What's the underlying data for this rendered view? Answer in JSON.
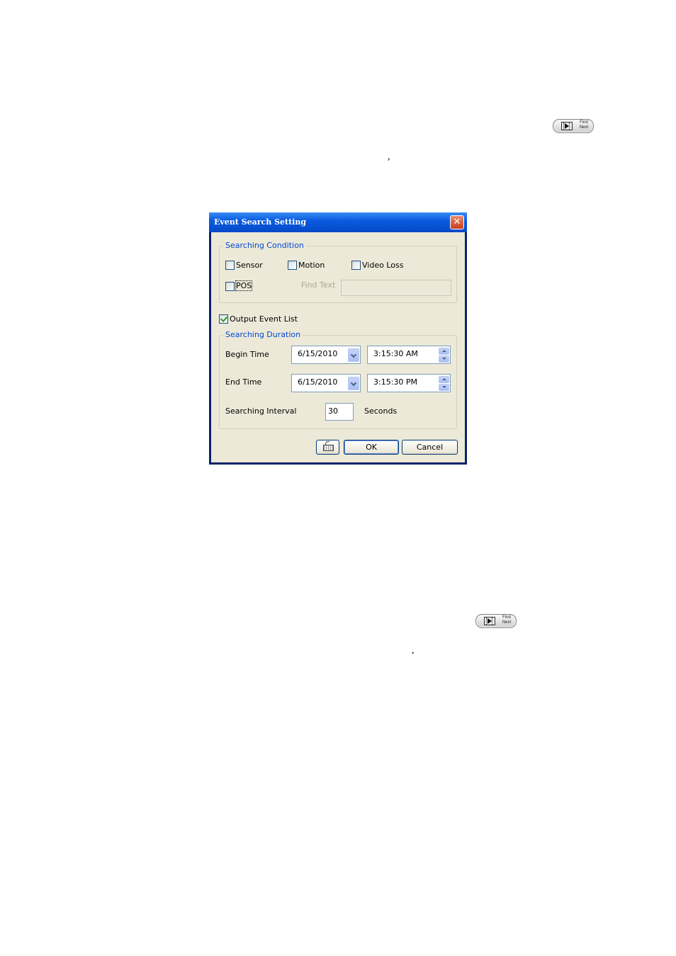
{
  "doc": {
    "comma_1": ",",
    "comma_2": ",",
    "find_next_label_top": "Find\nNext",
    "find_next_label_bottom": "Find\nNext"
  },
  "dialog": {
    "title": "Event Search Setting",
    "close_glyph": "✕",
    "searching_condition": {
      "legend": "Searching Condition",
      "sensor": {
        "label": "Sensor",
        "checked": false
      },
      "motion": {
        "label": "Motion",
        "checked": false
      },
      "video_loss": {
        "label": "Video Loss",
        "checked": false
      },
      "pos": {
        "label": "POS",
        "checked": false
      },
      "find_text_label": "Find Text",
      "find_text_value": ""
    },
    "output_event_list": {
      "label": "Output Event List",
      "checked": true
    },
    "searching_duration": {
      "legend": "Searching Duration",
      "begin_time_label": "Begin Time",
      "begin_date": "6/15/2010",
      "begin_time": "3:15:30 AM",
      "end_time_label": "End Time",
      "end_date": "6/15/2010",
      "end_time": "3:15:30 PM",
      "interval_label": "Searching Interval",
      "interval_value": "30",
      "interval_unit": "Seconds"
    },
    "buttons": {
      "ok": "OK",
      "cancel": "Cancel",
      "keyboard_icon": "keyboard-icon"
    }
  }
}
